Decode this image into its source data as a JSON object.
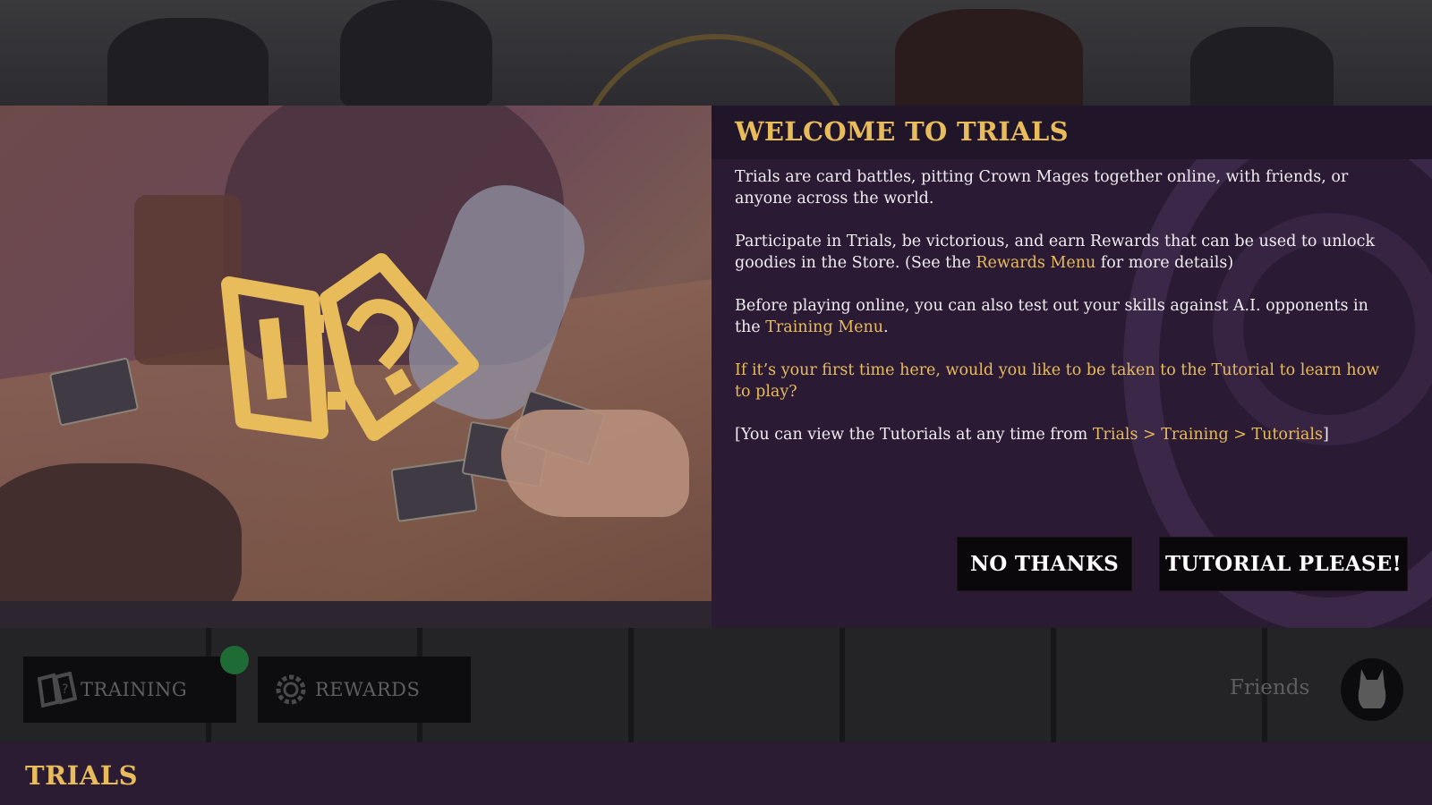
{
  "modal": {
    "title": "WELCOME TO TRIALS",
    "paragraphs": {
      "p1": "Trials are card battles, pitting Crown Mages together online, with friends, or anyone across the world.",
      "p2_before": "Participate in Trials, be victorious, and earn Rewards that can be used to unlock goodies in the Store. (See the ",
      "p2_link": "Rewards Menu",
      "p2_after": " for more details)",
      "p3_before": "Before playing online, you can also test out your skills against A.I. opponents in the ",
      "p3_link": "Training Menu",
      "p3_after": ".",
      "p4": "If it’s your first time here, would you like to be taken to the Tutorial to learn how to play?",
      "p5_before": "[You can view the Tutorials at any time from ",
      "p5_link": "Trials > Training > Tutorials",
      "p5_after": "]"
    },
    "buttons": {
      "no_thanks": "NO THANKS",
      "tutorial": "TUTORIAL PLEASE!"
    }
  },
  "bottom_bar": {
    "training_label": "TRAINING",
    "rewards_label": "REWARDS",
    "friends_label": "Friends"
  },
  "footer": {
    "title": "TRIALS"
  },
  "colors": {
    "accent_gold": "#e8bc5a",
    "panel_purple": "#2a1a33",
    "button_black": "#0b080c"
  },
  "icons": {
    "trials_logo": "card-question-icon",
    "training": "card-question-icon",
    "rewards": "gear-badge-icon",
    "friends_avatar": "cat-silhouette-icon"
  }
}
